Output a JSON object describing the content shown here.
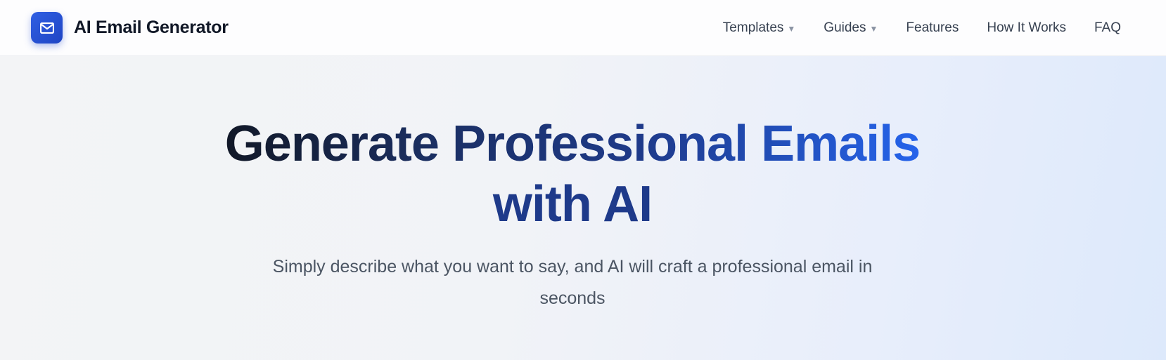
{
  "brand": {
    "name": "AI Email Generator",
    "logo_icon": "mail-icon",
    "logo_color": "#2b56d9"
  },
  "nav": {
    "items": [
      {
        "label": "Templates",
        "has_dropdown": true
      },
      {
        "label": "Guides",
        "has_dropdown": true
      },
      {
        "label": "Features",
        "has_dropdown": false
      },
      {
        "label": "How It Works",
        "has_dropdown": false
      },
      {
        "label": "FAQ",
        "has_dropdown": false
      }
    ],
    "dropdown_glyph": "▼"
  },
  "hero": {
    "title_line1": "Generate Professional Emails",
    "title_line2": "with AI",
    "subtitle": "Simply describe what you want to say, and AI will craft a professional email in seconds"
  },
  "colors": {
    "title_dark": "#111827",
    "title_blue": "#2563eb",
    "accent": "#1e3a8a",
    "text_muted": "#4b5563"
  }
}
